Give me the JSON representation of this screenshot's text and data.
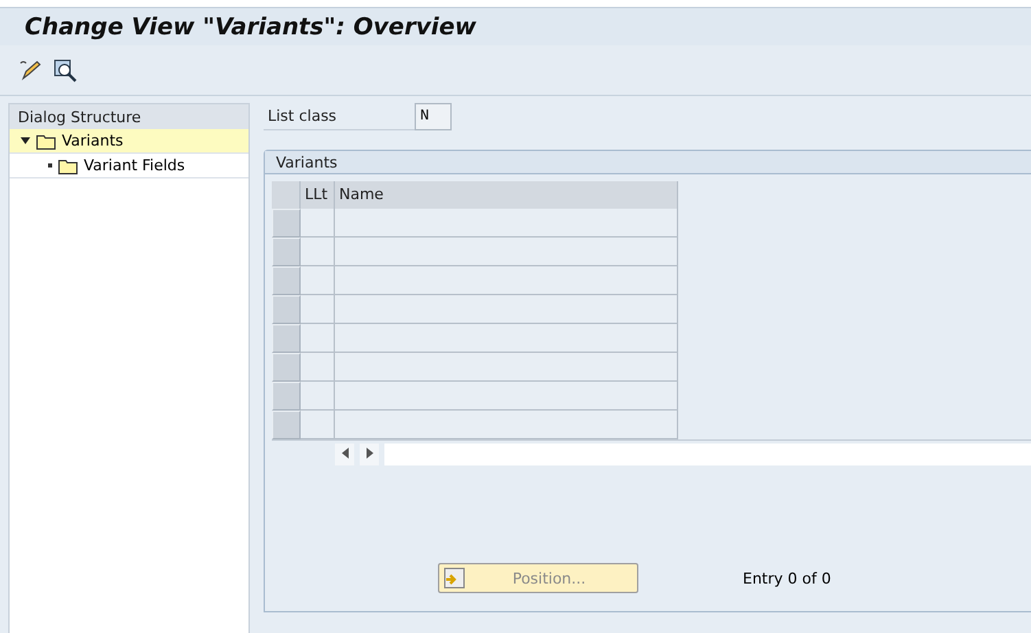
{
  "window": {
    "title": "Change View \"Variants\": Overview"
  },
  "sidebar": {
    "title": "Dialog Structure",
    "items": [
      {
        "label": "Variants",
        "expanded": true,
        "selected": true,
        "children": [
          {
            "label": "Variant Fields",
            "selected": false
          }
        ]
      }
    ]
  },
  "list_class": {
    "label": "List class",
    "value": "N"
  },
  "table": {
    "title": "Variants",
    "columns": [
      "LLt",
      "Name"
    ]
  },
  "position_button": {
    "label": "Position...",
    "disabled": true
  },
  "entry_text": "Entry 0 of 0"
}
